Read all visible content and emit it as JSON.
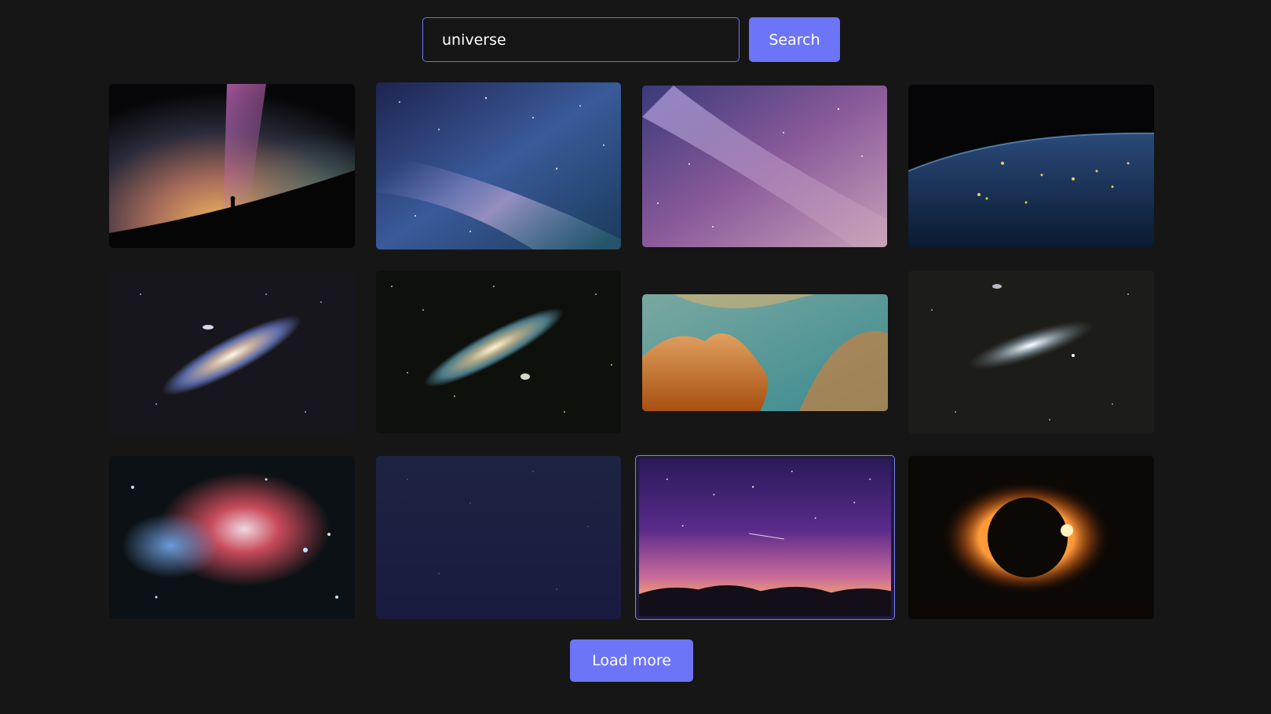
{
  "search": {
    "value": "universe",
    "button_label": "Search"
  },
  "accent_color": "#6c74f7",
  "background_color": "#161616",
  "gallery": {
    "images": [
      {
        "subject": "milky-way-silhouette"
      },
      {
        "subject": "blue-milky-way"
      },
      {
        "subject": "purple-milky-way"
      },
      {
        "subject": "earth-night-lights"
      },
      {
        "subject": "andromeda-galaxy"
      },
      {
        "subject": "andromeda-galaxy-starfield"
      },
      {
        "subject": "orange-teal-nebula"
      },
      {
        "subject": "galaxy-dark"
      },
      {
        "subject": "orion-nebula"
      },
      {
        "subject": "dark-blue-night-sky"
      },
      {
        "subject": "purple-sky-shooting-star",
        "selected": true
      },
      {
        "subject": "solar-eclipse"
      }
    ]
  },
  "load_more_label": "Load more"
}
